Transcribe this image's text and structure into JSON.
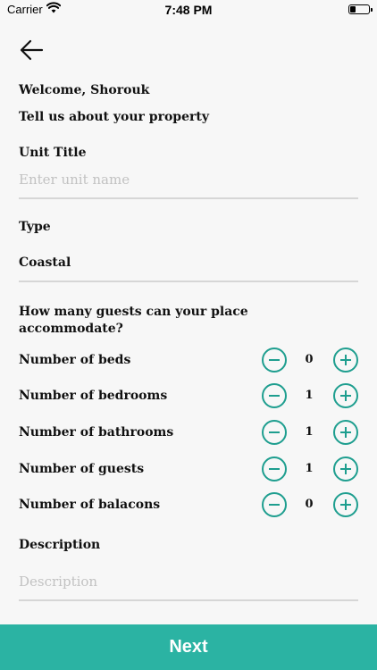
{
  "status_bar": {
    "carrier": "Carrier",
    "time": "7:48 PM"
  },
  "header": {
    "welcome": "Welcome, Shorouk",
    "subtitle": "Tell us about your property"
  },
  "unit_title": {
    "label": "Unit Title",
    "placeholder": "Enter unit name",
    "value": ""
  },
  "type": {
    "label": "Type",
    "value": "Coastal"
  },
  "guests_question": "How many guests can your place accommodate?",
  "counters": [
    {
      "label": "Number of beds",
      "value": "0"
    },
    {
      "label": "Number of bedrooms",
      "value": "1"
    },
    {
      "label": "Number of bathrooms",
      "value": "1"
    },
    {
      "label": "Number of guests",
      "value": "1"
    },
    {
      "label": "Number of balacons",
      "value": "0"
    }
  ],
  "description": {
    "label": "Description",
    "placeholder": "Description",
    "value": ""
  },
  "next_button": "Next",
  "colors": {
    "accent": "#2bb3a3",
    "stepper": "#1e9e8f",
    "background": "#f7f7f7"
  },
  "icons": {
    "back": "arrow-left-icon",
    "minus": "minus-circle-icon",
    "plus": "plus-circle-icon"
  }
}
